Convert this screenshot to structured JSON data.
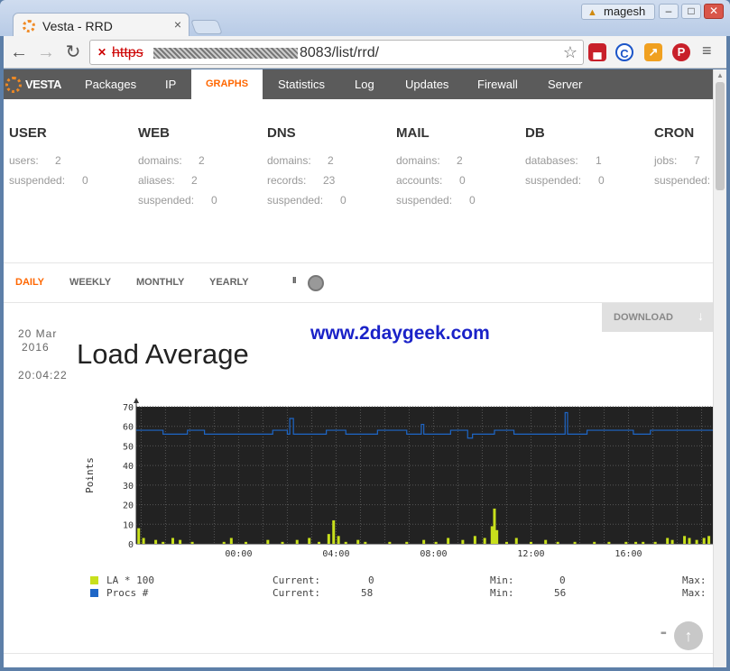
{
  "browser": {
    "tab_title": "Vesta - RRD",
    "tab_close": "×",
    "profile_name": "magesh",
    "url_protocol": "https",
    "url_rest": "8083/list/rrd/"
  },
  "topnav": {
    "logo_text": "VESTA",
    "items": [
      "Packages",
      "IP",
      "GRAPHS",
      "Statistics",
      "Log",
      "Updates",
      "Firewall",
      "Server"
    ],
    "active": "GRAPHS"
  },
  "stats": {
    "user": {
      "title": "USER",
      "rows": [
        [
          "users:",
          "2"
        ],
        [
          "suspended:",
          "0"
        ]
      ]
    },
    "web": {
      "title": "WEB",
      "rows": [
        [
          "domains:",
          "2"
        ],
        [
          "aliases:",
          "2"
        ],
        [
          "suspended:",
          "0"
        ]
      ]
    },
    "dns": {
      "title": "DNS",
      "rows": [
        [
          "domains:",
          "2"
        ],
        [
          "records:",
          "23"
        ],
        [
          "suspended:",
          "0"
        ]
      ]
    },
    "mail": {
      "title": "MAIL",
      "rows": [
        [
          "domains:",
          "2"
        ],
        [
          "accounts:",
          "0"
        ],
        [
          "suspended:",
          "0"
        ]
      ]
    },
    "db": {
      "title": "DB",
      "rows": [
        [
          "databases:",
          "1"
        ],
        [
          "suspended:",
          "0"
        ]
      ]
    },
    "cron": {
      "title": "CRON",
      "rows": [
        [
          "jobs:",
          "7"
        ],
        [
          "suspended:",
          ""
        ]
      ]
    }
  },
  "periods": [
    "DAILY",
    "WEEKLY",
    "MONTHLY",
    "YEARLY"
  ],
  "pause_label": "II",
  "download_label": "DOWNLOAD",
  "watermark": "www.2daygeek.com",
  "date": {
    "day": "20  Mar",
    "year": "2016",
    "time": "20:04:22"
  },
  "graph_title": "Load Average",
  "chart_data": {
    "type": "bar",
    "ylabel": "Points",
    "xlabel": "",
    "ylim": [
      0,
      70
    ],
    "y_ticks": [
      0,
      10,
      20,
      30,
      40,
      50,
      60,
      70
    ],
    "x_tick_labels": [
      "00:00",
      "04:00",
      "08:00",
      "12:00",
      "16:00"
    ],
    "x_range_hours": [
      -4.2,
      19.5
    ],
    "background": "#222222",
    "series": [
      {
        "name": "LA * 100",
        "type": "bar",
        "color": "#c8e01c",
        "points": [
          [
            -4.1,
            8
          ],
          [
            -3.9,
            3
          ],
          [
            -3.4,
            2
          ],
          [
            -3.1,
            1
          ],
          [
            -2.7,
            3
          ],
          [
            -2.4,
            2
          ],
          [
            -1.9,
            1
          ],
          [
            -0.6,
            1
          ],
          [
            -0.3,
            3
          ],
          [
            0.3,
            1
          ],
          [
            1.2,
            2
          ],
          [
            1.8,
            1
          ],
          [
            2.4,
            2
          ],
          [
            2.9,
            3
          ],
          [
            3.3,
            1
          ],
          [
            3.7,
            5
          ],
          [
            3.9,
            12
          ],
          [
            4.1,
            4
          ],
          [
            4.4,
            1
          ],
          [
            4.9,
            2
          ],
          [
            5.2,
            1
          ],
          [
            6.2,
            1
          ],
          [
            6.9,
            1
          ],
          [
            7.6,
            2
          ],
          [
            8.1,
            1
          ],
          [
            8.6,
            3
          ],
          [
            9.2,
            2
          ],
          [
            9.7,
            4
          ],
          [
            10.1,
            3
          ],
          [
            10.4,
            9
          ],
          [
            10.5,
            18
          ],
          [
            10.6,
            7
          ],
          [
            11.0,
            1
          ],
          [
            11.4,
            3
          ],
          [
            12.0,
            1
          ],
          [
            12.6,
            2
          ],
          [
            13.1,
            1
          ],
          [
            13.8,
            1
          ],
          [
            14.6,
            1
          ],
          [
            15.2,
            1
          ],
          [
            15.9,
            1
          ],
          [
            16.3,
            1
          ],
          [
            16.6,
            1
          ],
          [
            17.1,
            1
          ],
          [
            17.6,
            3
          ],
          [
            17.8,
            2
          ],
          [
            18.3,
            4
          ],
          [
            18.5,
            3
          ],
          [
            18.8,
            2
          ],
          [
            19.1,
            3
          ],
          [
            19.3,
            4
          ]
        ]
      },
      {
        "name": "Procs #",
        "type": "line",
        "color": "#1e66c6",
        "points": [
          [
            -4.2,
            58
          ],
          [
            -3.2,
            58
          ],
          [
            -3.1,
            56
          ],
          [
            -2.2,
            56
          ],
          [
            -2.1,
            58
          ],
          [
            -1.5,
            58
          ],
          [
            -1.4,
            56
          ],
          [
            1.3,
            56
          ],
          [
            1.4,
            58
          ],
          [
            1.9,
            58
          ],
          [
            2.0,
            56
          ],
          [
            2.1,
            64
          ],
          [
            2.25,
            56
          ],
          [
            3.5,
            56
          ],
          [
            3.6,
            58
          ],
          [
            4.3,
            58
          ],
          [
            4.4,
            56
          ],
          [
            5.6,
            56
          ],
          [
            5.7,
            58
          ],
          [
            6.8,
            58
          ],
          [
            6.9,
            56
          ],
          [
            7.4,
            56
          ],
          [
            7.5,
            61
          ],
          [
            7.6,
            56
          ],
          [
            8.6,
            56
          ],
          [
            8.7,
            58
          ],
          [
            9.3,
            58
          ],
          [
            9.4,
            54
          ],
          [
            9.6,
            56
          ],
          [
            10.4,
            56
          ],
          [
            10.5,
            58
          ],
          [
            11.2,
            58
          ],
          [
            11.3,
            56
          ],
          [
            13.3,
            56
          ],
          [
            13.4,
            67
          ],
          [
            13.5,
            56
          ],
          [
            14.2,
            56
          ],
          [
            14.3,
            58
          ],
          [
            16.1,
            58
          ],
          [
            16.2,
            56
          ],
          [
            16.8,
            56
          ],
          [
            16.9,
            58
          ],
          [
            19.5,
            58
          ]
        ]
      }
    ],
    "legend": [
      {
        "name": "LA * 100",
        "current": "0",
        "min": "0",
        "max": ""
      },
      {
        "name": "Procs #",
        "current": "58",
        "min": "56",
        "max": ""
      }
    ],
    "legend_labels": {
      "current": "Current:",
      "min": "Min:",
      "max": "Max:"
    }
  },
  "colors": {
    "accent": "#ff6701",
    "nav_bg": "#5b5b5b",
    "watermark": "#1a22c8"
  }
}
